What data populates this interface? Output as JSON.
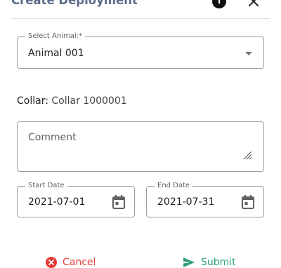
{
  "dialog": {
    "title": "Create Deployment",
    "info_icon": "info-icon",
    "close_icon": "close-icon"
  },
  "form": {
    "animal": {
      "label": "Select Animal:*",
      "value": "Animal 001"
    },
    "collar": {
      "label": "Collar:",
      "value": "Collar 1000001"
    },
    "comment": {
      "placeholder": "Comment"
    },
    "start_date": {
      "label": "Start Date",
      "value": "2021-07-01"
    },
    "end_date": {
      "label": "End Date",
      "value": "2021-07-31"
    }
  },
  "actions": {
    "cancel_label": "Cancel",
    "submit_label": "Submit"
  },
  "colors": {
    "title": "#5c6b8a",
    "cancel": "#e53935",
    "submit": "#2e9e7a",
    "border": "#9e9e9e"
  }
}
